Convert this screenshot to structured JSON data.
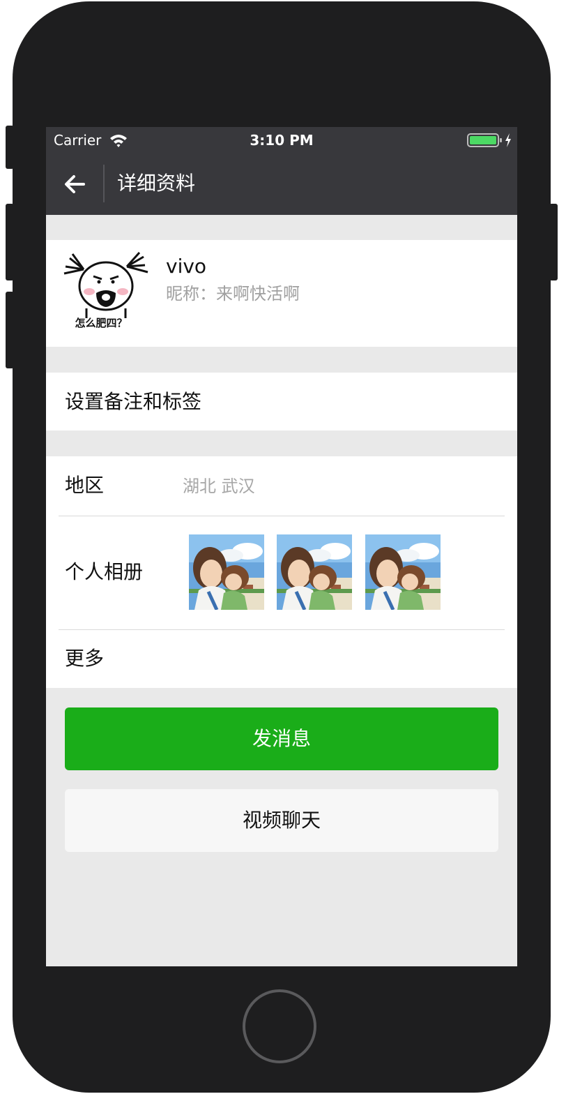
{
  "status_bar": {
    "carrier": "Carrier",
    "time": "3:10 PM",
    "icons": [
      "wifi-icon",
      "battery-icon",
      "charging-bolt-icon"
    ]
  },
  "nav": {
    "back_icon": "arrow-left-icon",
    "title": "详细资料"
  },
  "profile": {
    "avatar_caption": "怎么肥四？",
    "name": "vivo",
    "nickname": "昵称：来啊快活啊"
  },
  "remark_row": {
    "label": "设置备注和标签"
  },
  "info": {
    "region_label": "地区",
    "region_value": "湖北 武汉",
    "album_label": "个人相册",
    "album_photo_count": 3,
    "more_label": "更多"
  },
  "actions": {
    "send_message": "发消息",
    "video_chat": "视频聊天"
  },
  "colors": {
    "nav_background": "#38383c",
    "primary_green": "#1aad19",
    "page_background": "#e9e9e9",
    "secondary_text": "#a0a0a0"
  }
}
